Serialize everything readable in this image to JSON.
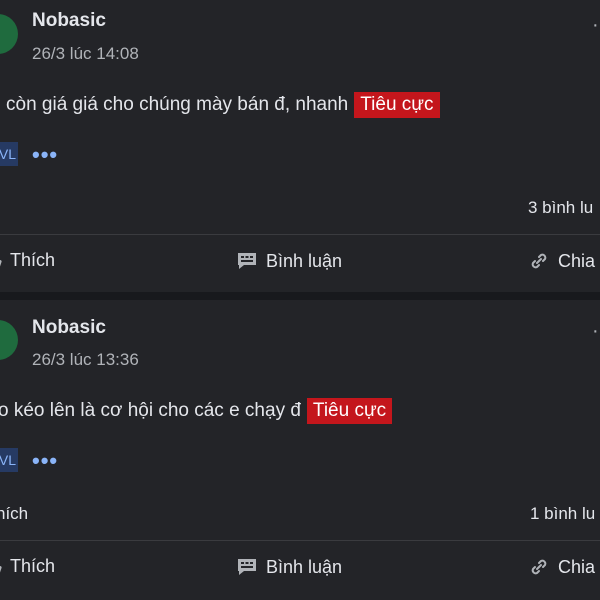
{
  "posts": [
    {
      "author": "Nobasic",
      "time": "26/3 lúc 14:08",
      "text": "còn giá giá cho chúng mày bán đ, nhanh",
      "tag": "Tiêu cực",
      "chip": "VL",
      "more": "•••",
      "comments": "3 bình lu",
      "likes": "",
      "actions": {
        "like": "Thích",
        "comment": "Bình luận",
        "share": "Chia"
      }
    },
    {
      "author": "Nobasic",
      "time": "26/3 lúc 13:36",
      "text": "o kéo lên là cơ hội cho các e chạy đ",
      "tag": "Tiêu cực",
      "chip": "VL",
      "more": "•••",
      "comments": "1 bình lu",
      "likes": "hích",
      "actions": {
        "like": "Thích",
        "comment": "Bình luận",
        "share": "Chia"
      }
    }
  ],
  "colors": {
    "background": "#18191d",
    "card": "#232428",
    "tag_bg": "#c4161c",
    "link": "#8ab4f8",
    "avatar": "#1f6b3e"
  },
  "icons": {
    "like": "thumbs-up-icon",
    "comment": "comment-icon",
    "share": "link-icon"
  }
}
